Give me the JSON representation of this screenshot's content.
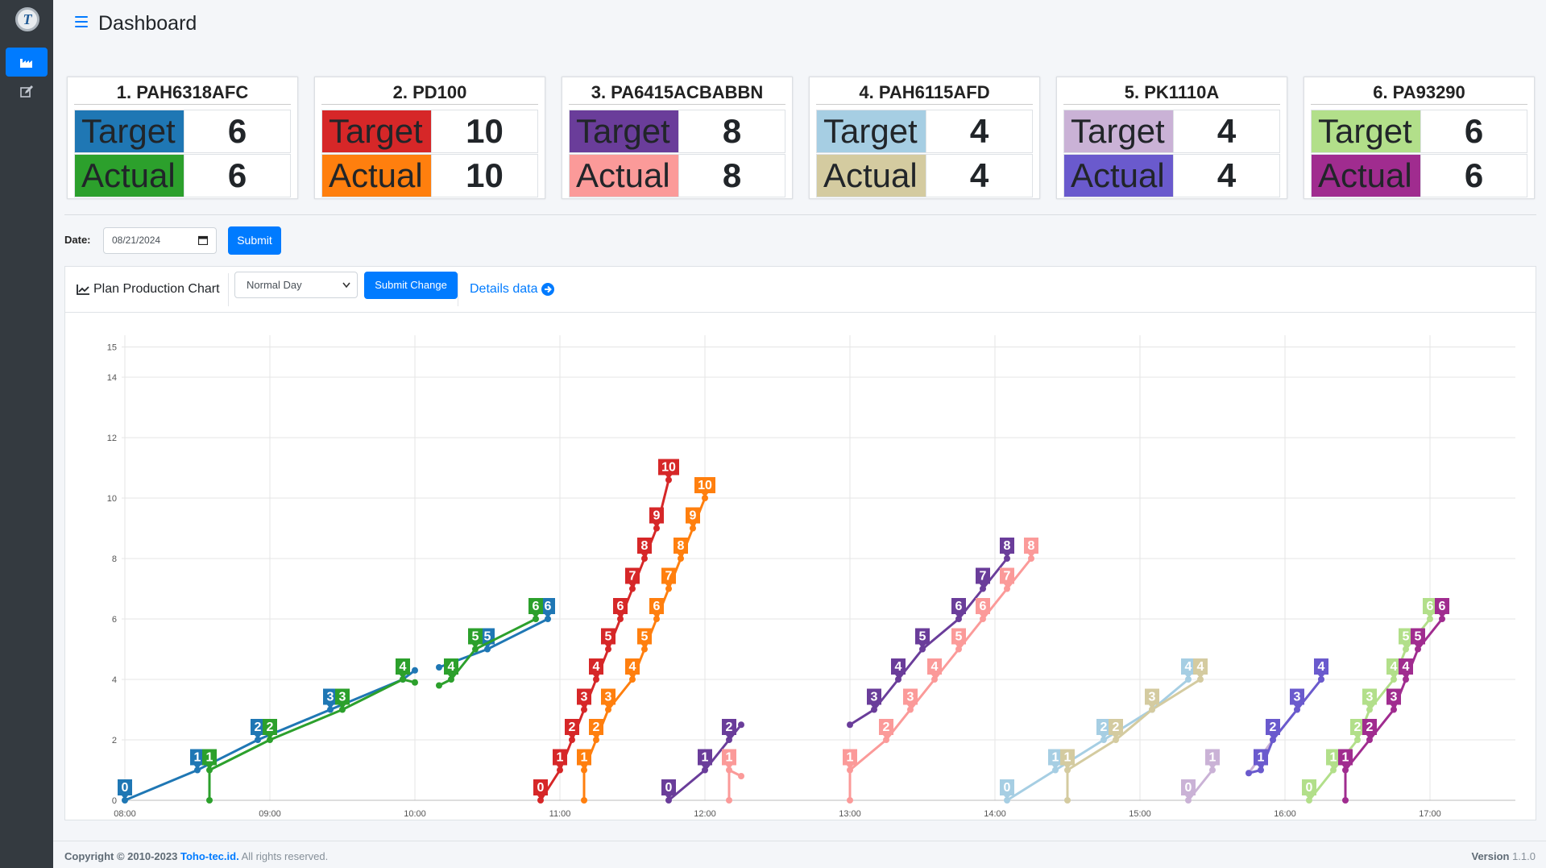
{
  "header": {
    "title": "Dashboard"
  },
  "sidebar": {
    "items": [
      {
        "icon": "factory-icon",
        "active": true
      },
      {
        "icon": "edit-icon",
        "active": false
      }
    ]
  },
  "cards": [
    {
      "title": "1. PAH6318AFC",
      "target_label": "Target",
      "actual_label": "Actual",
      "target": "6",
      "actual": "6",
      "target_color": "#1f77b4",
      "actual_color": "#2ca02c"
    },
    {
      "title": "2. PD100",
      "target_label": "Target",
      "actual_label": "Actual",
      "target": "10",
      "actual": "10",
      "target_color": "#d62728",
      "actual_color": "#ff7f0e"
    },
    {
      "title": "3. PA6415ACBABBN",
      "target_label": "Target",
      "actual_label": "Actual",
      "target": "8",
      "actual": "8",
      "target_color": "#6a3d9a",
      "actual_color": "#fb9a99"
    },
    {
      "title": "4. PAH6115AFD",
      "target_label": "Target",
      "actual_label": "Actual",
      "target": "4",
      "actual": "4",
      "target_color": "#a6cee3",
      "actual_color": "#d4cba0"
    },
    {
      "title": "5. PK1110A",
      "target_label": "Target",
      "actual_label": "Actual",
      "target": "4",
      "actual": "4",
      "target_color": "#cab2d6",
      "actual_color": "#6a5acd"
    },
    {
      "title": "6. PA93290",
      "target_label": "Target",
      "actual_label": "Actual",
      "target": "6",
      "actual": "6",
      "target_color": "#b2df8a",
      "actual_color": "#a02c8f"
    }
  ],
  "filter": {
    "date_label": "Date:",
    "date_value": "08/21/2024",
    "submit_label": "Submit"
  },
  "chart_panel": {
    "title": "Plan Production Chart",
    "select_value": "Normal Day",
    "submit_change_label": "Submit Change",
    "details_label": "Details data"
  },
  "chart_data": {
    "type": "line",
    "xlim": [
      "08:00",
      "17:35"
    ],
    "ylim": [
      0,
      15
    ],
    "x_ticks": [
      "08:00",
      "09:00",
      "10:00",
      "11:00",
      "12:00",
      "13:00",
      "14:00",
      "15:00",
      "16:00",
      "17:00"
    ],
    "y_ticks": [
      0,
      2,
      4,
      6,
      8,
      10,
      12,
      14,
      15
    ],
    "grid": true,
    "series": [
      {
        "color": "#1f77b4",
        "points": [
          [
            "08:00",
            0
          ],
          [
            "08:30",
            1
          ],
          [
            "08:55",
            2
          ],
          [
            "09:25",
            3
          ],
          [
            "09:55",
            4
          ],
          [
            "10:00",
            4.3
          ]
        ],
        "labels": [
          [
            "08:00",
            0,
            "0"
          ],
          [
            "08:30",
            1,
            "1"
          ],
          [
            "08:55",
            2,
            "2"
          ],
          [
            "09:25",
            3,
            "3"
          ],
          [
            "09:55",
            4,
            "4"
          ]
        ]
      },
      {
        "color": "#2ca02c",
        "points": [
          [
            "08:35",
            0
          ],
          [
            "08:35",
            1
          ],
          [
            "09:00",
            2
          ],
          [
            "09:30",
            3
          ],
          [
            "09:55",
            4
          ],
          [
            "10:00",
            3.9
          ]
        ],
        "labels": [
          [
            "08:35",
            1,
            "1"
          ],
          [
            "09:00",
            2,
            "2"
          ],
          [
            "09:30",
            3,
            "3"
          ],
          [
            "09:55",
            4,
            "4"
          ]
        ]
      },
      {
        "color": "#1f77b4",
        "points": [
          [
            "10:10",
            4.4
          ],
          [
            "10:30",
            5
          ],
          [
            "10:55",
            6
          ]
        ],
        "labels": [
          [
            "10:30",
            5,
            "5"
          ],
          [
            "10:55",
            6,
            "6"
          ]
        ]
      },
      {
        "color": "#2ca02c",
        "points": [
          [
            "10:10",
            3.8
          ],
          [
            "10:15",
            4
          ],
          [
            "10:25",
            5
          ],
          [
            "10:50",
            6
          ]
        ],
        "labels": [
          [
            "10:15",
            4,
            "4"
          ],
          [
            "10:25",
            5,
            "5"
          ],
          [
            "10:50",
            6,
            "6"
          ]
        ]
      },
      {
        "color": "#d62728",
        "points": [
          [
            "10:52",
            0
          ],
          [
            "11:00",
            1
          ],
          [
            "11:05",
            2
          ],
          [
            "11:10",
            3
          ],
          [
            "11:15",
            4
          ],
          [
            "11:20",
            5
          ],
          [
            "11:25",
            6
          ],
          [
            "11:30",
            7
          ],
          [
            "11:35",
            8
          ],
          [
            "11:40",
            9
          ],
          [
            "11:45",
            10.6
          ]
        ],
        "labels": [
          [
            "10:52",
            0,
            "0"
          ],
          [
            "11:00",
            1,
            "1"
          ],
          [
            "11:05",
            2,
            "2"
          ],
          [
            "11:10",
            3,
            "3"
          ],
          [
            "11:15",
            4,
            "4"
          ],
          [
            "11:20",
            5,
            "5"
          ],
          [
            "11:25",
            6,
            "6"
          ],
          [
            "11:30",
            7,
            "7"
          ],
          [
            "11:35",
            8,
            "8"
          ],
          [
            "11:40",
            9,
            "9"
          ],
          [
            "11:45",
            10.6,
            "10"
          ]
        ]
      },
      {
        "color": "#ff7f0e",
        "points": [
          [
            "11:10",
            0
          ],
          [
            "11:10",
            1
          ],
          [
            "11:15",
            2
          ],
          [
            "11:20",
            3
          ],
          [
            "11:30",
            4
          ],
          [
            "11:35",
            5
          ],
          [
            "11:40",
            6
          ],
          [
            "11:45",
            7
          ],
          [
            "11:50",
            8
          ],
          [
            "11:55",
            9
          ],
          [
            "12:00",
            10
          ]
        ],
        "labels": [
          [
            "11:10",
            1,
            "1"
          ],
          [
            "11:15",
            2,
            "2"
          ],
          [
            "11:20",
            3,
            "3"
          ],
          [
            "11:30",
            4,
            "4"
          ],
          [
            "11:35",
            5,
            "5"
          ],
          [
            "11:40",
            6,
            "6"
          ],
          [
            "11:45",
            7,
            "7"
          ],
          [
            "11:50",
            8,
            "8"
          ],
          [
            "11:55",
            9,
            "9"
          ],
          [
            "12:00",
            10,
            "10"
          ]
        ]
      },
      {
        "color": "#6a3d9a",
        "points": [
          [
            "11:45",
            0
          ],
          [
            "12:00",
            1
          ],
          [
            "12:10",
            2
          ],
          [
            "12:15",
            2.5
          ]
        ],
        "labels": [
          [
            "11:45",
            0,
            "0"
          ],
          [
            "12:00",
            1,
            "1"
          ],
          [
            "12:10",
            2,
            "2"
          ]
        ]
      },
      {
        "color": "#fb9a99",
        "points": [
          [
            "12:10",
            0
          ],
          [
            "12:10",
            1
          ],
          [
            "12:15",
            0.8
          ]
        ],
        "labels": [
          [
            "12:10",
            1,
            "1"
          ]
        ]
      },
      {
        "color": "#6a3d9a",
        "points": [
          [
            "13:00",
            2.5
          ],
          [
            "13:10",
            3
          ],
          [
            "13:20",
            4
          ],
          [
            "13:30",
            5
          ],
          [
            "13:45",
            6
          ],
          [
            "13:55",
            7
          ],
          [
            "14:05",
            8
          ]
        ],
        "labels": [
          [
            "13:10",
            3,
            "3"
          ],
          [
            "13:20",
            4,
            "4"
          ],
          [
            "13:30",
            5,
            "5"
          ],
          [
            "13:45",
            6,
            "6"
          ],
          [
            "13:55",
            7,
            "7"
          ],
          [
            "14:05",
            8,
            "8"
          ]
        ]
      },
      {
        "color": "#fb9a99",
        "points": [
          [
            "13:00",
            0
          ],
          [
            "13:00",
            1
          ],
          [
            "13:15",
            2
          ],
          [
            "13:25",
            3
          ],
          [
            "13:35",
            4
          ],
          [
            "13:45",
            5
          ],
          [
            "13:55",
            6
          ],
          [
            "14:05",
            7
          ],
          [
            "14:15",
            8
          ]
        ],
        "labels": [
          [
            "13:00",
            1,
            "1"
          ],
          [
            "13:15",
            2,
            "2"
          ],
          [
            "13:25",
            3,
            "3"
          ],
          [
            "13:35",
            4,
            "4"
          ],
          [
            "13:45",
            5,
            "5"
          ],
          [
            "13:55",
            6,
            "6"
          ],
          [
            "14:05",
            7,
            "7"
          ],
          [
            "14:15",
            8,
            "8"
          ]
        ]
      },
      {
        "color": "#a6cee3",
        "points": [
          [
            "14:05",
            0
          ],
          [
            "14:25",
            1
          ],
          [
            "14:45",
            2
          ],
          [
            "15:05",
            3
          ],
          [
            "15:20",
            4
          ]
        ],
        "labels": [
          [
            "14:05",
            0,
            "0"
          ],
          [
            "14:25",
            1,
            "1"
          ],
          [
            "14:45",
            2,
            "2"
          ],
          [
            "15:05",
            3,
            "3"
          ],
          [
            "15:20",
            4,
            "4"
          ]
        ]
      },
      {
        "color": "#d4cba0",
        "points": [
          [
            "14:30",
            0
          ],
          [
            "14:30",
            1
          ],
          [
            "14:50",
            2
          ],
          [
            "15:05",
            3
          ],
          [
            "15:25",
            4
          ]
        ],
        "labels": [
          [
            "14:30",
            1,
            "1"
          ],
          [
            "14:50",
            2,
            "2"
          ],
          [
            "15:05",
            3,
            "3"
          ],
          [
            "15:25",
            4,
            "4"
          ]
        ]
      },
      {
        "color": "#cab2d6",
        "points": [
          [
            "15:20",
            0
          ],
          [
            "15:30",
            1
          ]
        ],
        "labels": [
          [
            "15:20",
            0,
            "0"
          ],
          [
            "15:30",
            1,
            "1"
          ]
        ]
      },
      {
        "color": "#cab2d6",
        "points": [
          [
            "15:45",
            0.9
          ],
          [
            "15:55",
            2
          ],
          [
            "16:05",
            3
          ],
          [
            "16:15",
            4
          ]
        ],
        "labels": [
          [
            "15:55",
            2,
            "2"
          ],
          [
            "16:05",
            3,
            "3"
          ],
          [
            "16:15",
            4,
            "4"
          ]
        ]
      },
      {
        "color": "#6a5acd",
        "points": [
          [
            "15:45",
            0.9
          ],
          [
            "15:50",
            1
          ],
          [
            "15:55",
            2
          ],
          [
            "16:05",
            3
          ],
          [
            "16:15",
            4
          ]
        ],
        "labels": [
          [
            "15:50",
            1,
            "1"
          ],
          [
            "15:55",
            2,
            "2"
          ],
          [
            "16:05",
            3,
            "3"
          ],
          [
            "16:15",
            4,
            "4"
          ]
        ]
      },
      {
        "color": "#b2df8a",
        "points": [
          [
            "16:10",
            0
          ],
          [
            "16:20",
            1
          ],
          [
            "16:30",
            2
          ],
          [
            "16:35",
            3
          ],
          [
            "16:45",
            4
          ],
          [
            "16:50",
            5
          ],
          [
            "17:00",
            6
          ]
        ],
        "labels": [
          [
            "16:10",
            0,
            "0"
          ],
          [
            "16:20",
            1,
            "1"
          ],
          [
            "16:30",
            2,
            "2"
          ],
          [
            "16:35",
            3,
            "3"
          ],
          [
            "16:45",
            4,
            "4"
          ],
          [
            "16:50",
            5,
            "5"
          ],
          [
            "17:00",
            6,
            "6"
          ]
        ]
      },
      {
        "color": "#a02c8f",
        "points": [
          [
            "16:25",
            0
          ],
          [
            "16:25",
            1
          ],
          [
            "16:35",
            2
          ],
          [
            "16:45",
            3
          ],
          [
            "16:50",
            4
          ],
          [
            "16:55",
            5
          ],
          [
            "17:05",
            6
          ]
        ],
        "labels": [
          [
            "16:25",
            1,
            "1"
          ],
          [
            "16:35",
            2,
            "2"
          ],
          [
            "16:45",
            3,
            "3"
          ],
          [
            "16:50",
            4,
            "4"
          ],
          [
            "16:55",
            5,
            "5"
          ],
          [
            "17:05",
            6,
            "6"
          ]
        ]
      }
    ]
  },
  "footer": {
    "copyright": "Copyright © 2010-2023",
    "company": "Toho-tec.id.",
    "rights": "All rights reserved.",
    "version_label": "Version",
    "version": "1.1.0"
  }
}
